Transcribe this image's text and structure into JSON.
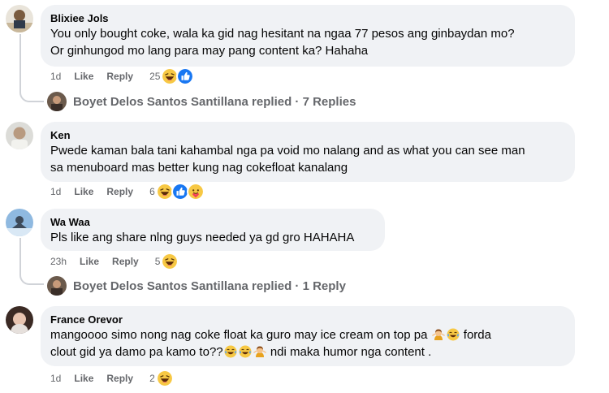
{
  "comments": [
    {
      "author": "Blixiee Jols",
      "text_l1": "You only bought coke, wala ka gid nag hesitant na ngaa 77 pesos ang ginbaydan mo?",
      "text_l2": "Or ginhungod mo lang para may pang content ka? Hahaha",
      "time": "1d",
      "like": "Like",
      "reply": "Reply",
      "reaction_count": "25",
      "reactions": [
        "haha",
        "like"
      ],
      "replies": {
        "text": "Boyet Delos Santos Santillana replied · 7 Replies"
      }
    },
    {
      "author": "Ken",
      "text_l1": "Pwede kaman bala tani kahambal nga pa void mo nalang and as what you can see man",
      "text_l2": "sa menuboard mas better kung nag cokefloat kanalang",
      "time": "1d",
      "like": "Like",
      "reply": "Reply",
      "reaction_count": "6",
      "reactions": [
        "haha",
        "like",
        "care"
      ]
    },
    {
      "author": "Wa Waa",
      "text_l1": "Pls like ang share nlng guys needed ya gd gro HAHAHA",
      "time": "23h",
      "like": "Like",
      "reply": "Reply",
      "reaction_count": "5",
      "reactions": [
        "haha"
      ],
      "replies": {
        "text": "Boyet Delos Santos Santillana replied · 1 Reply"
      }
    },
    {
      "author": "France Orevor",
      "text_l1a": "mangoooo simo nong nag coke float ka guro may ice cream on top pa",
      "text_l1b": "forda",
      "text_l2a": "clout gid ya damo pa kamo to??",
      "text_l2b": "ndi maka humor nga content .",
      "time": "1d",
      "like": "Like",
      "reply": "Reply",
      "reaction_count": "2",
      "reactions": [
        "haha"
      ]
    }
  ],
  "colors": {
    "bubble": "#f0f2f5",
    "meta": "#65676b",
    "like_blue": "#1877f2",
    "haha_yellow": "#f7b928"
  }
}
